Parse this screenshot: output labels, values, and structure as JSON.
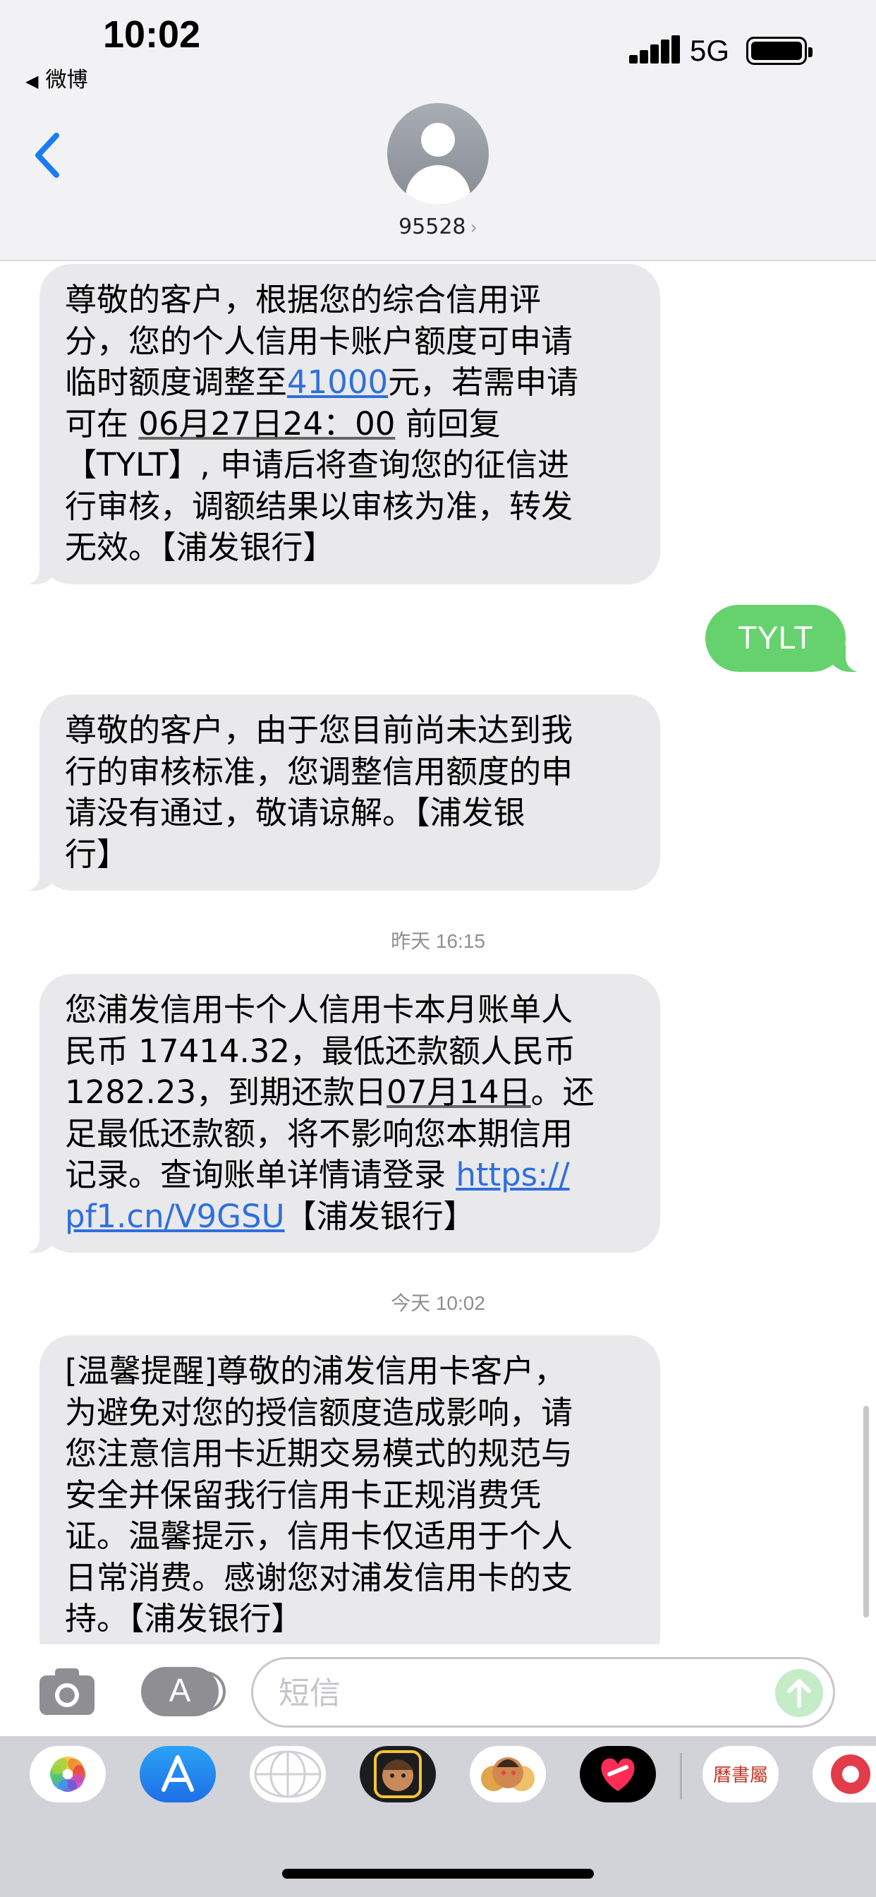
{
  "status_bar": {
    "time": "10:02",
    "back_app": "微博",
    "network": "5G"
  },
  "header": {
    "contact": "95528",
    "chevron": "›"
  },
  "colors": {
    "incoming_bubble": "#e9e9eb",
    "outgoing_bubble": "#65d26e",
    "accent_blue": "#2f6fde",
    "drawer_background": "#d1d3d9"
  },
  "messages": [
    {
      "direction": "incoming",
      "lines": [
        "尊敬的客户，根据您的综合信用评",
        "分，您的个人信用卡账户额度可申请",
        "临时额度调整至",
        "41000",
        "元，若需申请",
        "可在",
        "06月27日24：00",
        "前回复",
        "【TYLT】, 申请后将查询您的征信进",
        "行审核，调额结果以审核为准，转发",
        "无效。【浦发银行】"
      ]
    },
    {
      "direction": "outgoing",
      "text": "TYLT"
    },
    {
      "direction": "incoming",
      "lines": [
        "尊敬的客户，由于您目前尚未达到我",
        "行的审核标准，您调整信用额度的申",
        "请没有通过，敬请谅解。【浦发银",
        "行】"
      ]
    },
    {
      "direction": "incoming",
      "lines": [
        "您浦发信用卡个人信用卡本月账单人",
        "民币 17414.32，最低还款额人民币",
        "1282.23，到期还款日",
        "07月14日",
        "。还",
        "足最低还款额，将不影响您本期信用",
        "记录。查询账单详情请登录 ",
        "https://",
        "pf1.cn/V9GSU",
        "【浦发银行】"
      ]
    },
    {
      "direction": "incoming",
      "lines": [
        "[温馨提醒]尊敬的浦发信用卡客户，",
        "为避免对您的授信额度造成影响，请",
        "您注意信用卡近期交易模式的规范与",
        "安全并保留我行信用卡正规消费凭",
        "证。温馨提示，信用卡仅适用于个人",
        "日常消费。感谢您对浦发信用卡的支",
        "持。【浦发银行】"
      ]
    }
  ],
  "timestamps": [
    "昨天 16:15",
    "今天 10:02"
  ],
  "input": {
    "placeholder": "短信"
  },
  "app_drawer": {
    "apps": [
      {
        "icon": "photos-icon"
      },
      {
        "icon": "app-store-icon"
      },
      {
        "icon": "digital-touch-icon"
      },
      {
        "icon": "memoji-icon"
      },
      {
        "icon": "memoji-stickers-icon"
      },
      {
        "icon": "heart-app-icon"
      },
      {
        "icon": "calendar-app-icon",
        "logo_text": "曆書屬"
      },
      {
        "icon": "partial-app-icon"
      }
    ]
  }
}
